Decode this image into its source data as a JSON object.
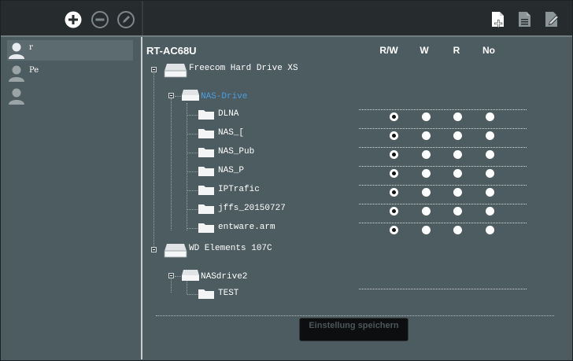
{
  "toolbar": {
    "left_icons": [
      "add-circle-icon",
      "remove-circle-icon",
      "edit-circle-icon"
    ],
    "right_icons": [
      "add-folder-icon",
      "document-icon",
      "edit-document-icon"
    ]
  },
  "users": [
    {
      "name": "r",
      "icon": "user-icon",
      "selected": true
    },
    {
      "name": "Pe",
      "icon": "user-icon",
      "selected": false
    },
    {
      "name": "",
      "icon": "user-icon",
      "selected": false
    }
  ],
  "main": {
    "router_name": "RT-AC68U",
    "columns": [
      "R/W",
      "W",
      "R",
      "No"
    ],
    "drives": [
      {
        "name": "Freecom Hard Drive XS",
        "partitions": [
          {
            "name": "NAS-Drive",
            "highlighted": true,
            "folders": [
              {
                "name": "DLNA",
                "selected": "R/W"
              },
              {
                "name": "NAS_[",
                "selected": "R/W"
              },
              {
                "name": "NAS_Pub",
                "selected": "R/W"
              },
              {
                "name": "NAS_P",
                "selected": "R/W"
              },
              {
                "name": "IPTrafic",
                "selected": "R/W"
              },
              {
                "name": "jffs_20150727",
                "selected": "R/W"
              },
              {
                "name": "entware.arm",
                "selected": "R/W"
              }
            ]
          }
        ]
      },
      {
        "name": "WD Elements 107C",
        "partitions": [
          {
            "name": "NASdrive2",
            "highlighted": false,
            "folders": [
              {
                "name": "TEST",
                "selected": null
              }
            ]
          }
        ]
      }
    ],
    "save_button": "Einstellung speichern"
  },
  "colors": {
    "accent_link": "#4a9fe0",
    "panel_bg": "#4d5c61",
    "topbar_bg": "#262c2e"
  }
}
